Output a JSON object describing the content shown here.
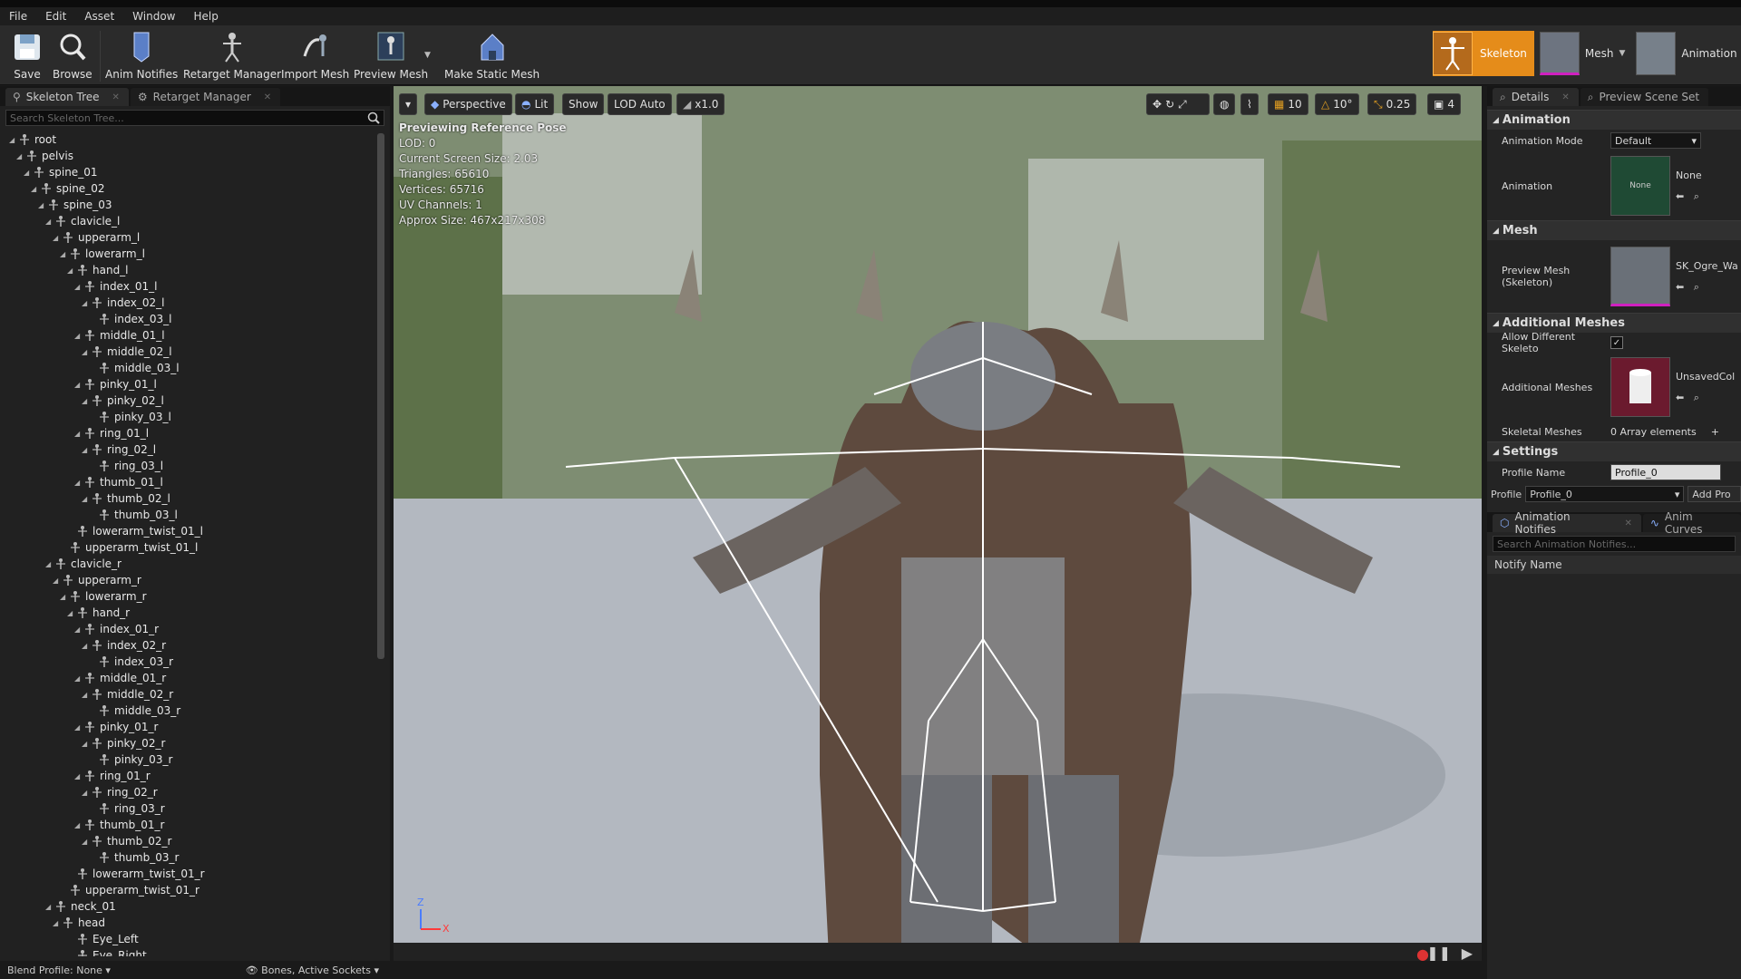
{
  "menu": [
    "File",
    "Edit",
    "Asset",
    "Window",
    "Help"
  ],
  "toolbar": {
    "buttons": [
      "Save",
      "Browse",
      "Anim Notifies",
      "Retarget Manager",
      "Import Mesh",
      "Preview Mesh",
      "Make Static Mesh"
    ],
    "modes": [
      "Skeleton",
      "Mesh",
      "Animation"
    ]
  },
  "left": {
    "tabs": [
      "Skeleton Tree",
      "Retarget Manager"
    ],
    "search_placeholder": "Search Skeleton Tree...",
    "bones": [
      {
        "name": "root",
        "depth": 0
      },
      {
        "name": "pelvis",
        "depth": 1
      },
      {
        "name": "spine_01",
        "depth": 2
      },
      {
        "name": "spine_02",
        "depth": 3
      },
      {
        "name": "spine_03",
        "depth": 4
      },
      {
        "name": "clavicle_l",
        "depth": 5
      },
      {
        "name": "upperarm_l",
        "depth": 6
      },
      {
        "name": "lowerarm_l",
        "depth": 7
      },
      {
        "name": "hand_l",
        "depth": 8
      },
      {
        "name": "index_01_l",
        "depth": 9
      },
      {
        "name": "index_02_l",
        "depth": 10
      },
      {
        "name": "index_03_l",
        "depth": 11
      },
      {
        "name": "middle_01_l",
        "depth": 9
      },
      {
        "name": "middle_02_l",
        "depth": 10
      },
      {
        "name": "middle_03_l",
        "depth": 11
      },
      {
        "name": "pinky_01_l",
        "depth": 9
      },
      {
        "name": "pinky_02_l",
        "depth": 10
      },
      {
        "name": "pinky_03_l",
        "depth": 11
      },
      {
        "name": "ring_01_l",
        "depth": 9
      },
      {
        "name": "ring_02_l",
        "depth": 10
      },
      {
        "name": "ring_03_l",
        "depth": 11
      },
      {
        "name": "thumb_01_l",
        "depth": 9
      },
      {
        "name": "thumb_02_l",
        "depth": 10
      },
      {
        "name": "thumb_03_l",
        "depth": 11
      },
      {
        "name": "lowerarm_twist_01_l",
        "depth": 8
      },
      {
        "name": "upperarm_twist_01_l",
        "depth": 7
      },
      {
        "name": "clavicle_r",
        "depth": 5
      },
      {
        "name": "upperarm_r",
        "depth": 6
      },
      {
        "name": "lowerarm_r",
        "depth": 7
      },
      {
        "name": "hand_r",
        "depth": 8
      },
      {
        "name": "index_01_r",
        "depth": 9
      },
      {
        "name": "index_02_r",
        "depth": 10
      },
      {
        "name": "index_03_r",
        "depth": 11
      },
      {
        "name": "middle_01_r",
        "depth": 9
      },
      {
        "name": "middle_02_r",
        "depth": 10
      },
      {
        "name": "middle_03_r",
        "depth": 11
      },
      {
        "name": "pinky_01_r",
        "depth": 9
      },
      {
        "name": "pinky_02_r",
        "depth": 10
      },
      {
        "name": "pinky_03_r",
        "depth": 11
      },
      {
        "name": "ring_01_r",
        "depth": 9
      },
      {
        "name": "ring_02_r",
        "depth": 10
      },
      {
        "name": "ring_03_r",
        "depth": 11
      },
      {
        "name": "thumb_01_r",
        "depth": 9
      },
      {
        "name": "thumb_02_r",
        "depth": 10
      },
      {
        "name": "thumb_03_r",
        "depth": 11
      },
      {
        "name": "lowerarm_twist_01_r",
        "depth": 8
      },
      {
        "name": "upperarm_twist_01_r",
        "depth": 7
      },
      {
        "name": "neck_01",
        "depth": 5
      },
      {
        "name": "head",
        "depth": 6
      },
      {
        "name": "Eye_Left",
        "depth": 8
      },
      {
        "name": "Eye_Right",
        "depth": 8
      }
    ],
    "blend_profile": "Blend Profile: None",
    "bones_filter": "Bones, Active Sockets"
  },
  "viewport": {
    "perspective": "Perspective",
    "lit": "Lit",
    "show": "Show",
    "lod": "LOD Auto",
    "speed": "x1.0",
    "grid_snap": "10",
    "rot_snap": "10°",
    "scale_snap": "0.25",
    "cam_speed": "4",
    "info_title": "Previewing Reference Pose",
    "info_lines": [
      "LOD: 0",
      "Current Screen Size: 2.03",
      "Triangles: 65610",
      "Vertices: 65716",
      "UV Channels: 1",
      "Approx Size: 467x217x308"
    ],
    "axis_z": "Z",
    "axis_x": "X"
  },
  "right": {
    "tabs": [
      "Details",
      "Preview Scene Set"
    ],
    "sections": {
      "animation": "Animation",
      "mesh": "Mesh",
      "additional": "Additional Meshes",
      "settings": "Settings"
    },
    "animation_mode_label": "Animation Mode",
    "animation_mode_value": "Default",
    "animation_label": "Animation",
    "animation_thumb": "None",
    "animation_value": "None",
    "preview_mesh_label": "Preview Mesh (Skeleton)",
    "preview_mesh_value": "SK_Ogre_Wa",
    "allow_diff_label": "Allow Different Skeleto",
    "additional_meshes_label": "Additional Meshes",
    "additional_meshes_value": "UnsavedCol",
    "skeletal_meshes_label": "Skeletal Meshes",
    "skeletal_meshes_value": "0 Array elements",
    "profile_name_label": "Profile Name",
    "profile_name_value": "Profile_0",
    "profile_label": "Profile",
    "profile_value": "Profile_0",
    "add_profile": "Add Pro",
    "notify_tabs": [
      "Animation Notifies",
      "Anim Curves"
    ],
    "notify_search": "Search Animation Notifies...",
    "notify_col": "Notify Name"
  }
}
